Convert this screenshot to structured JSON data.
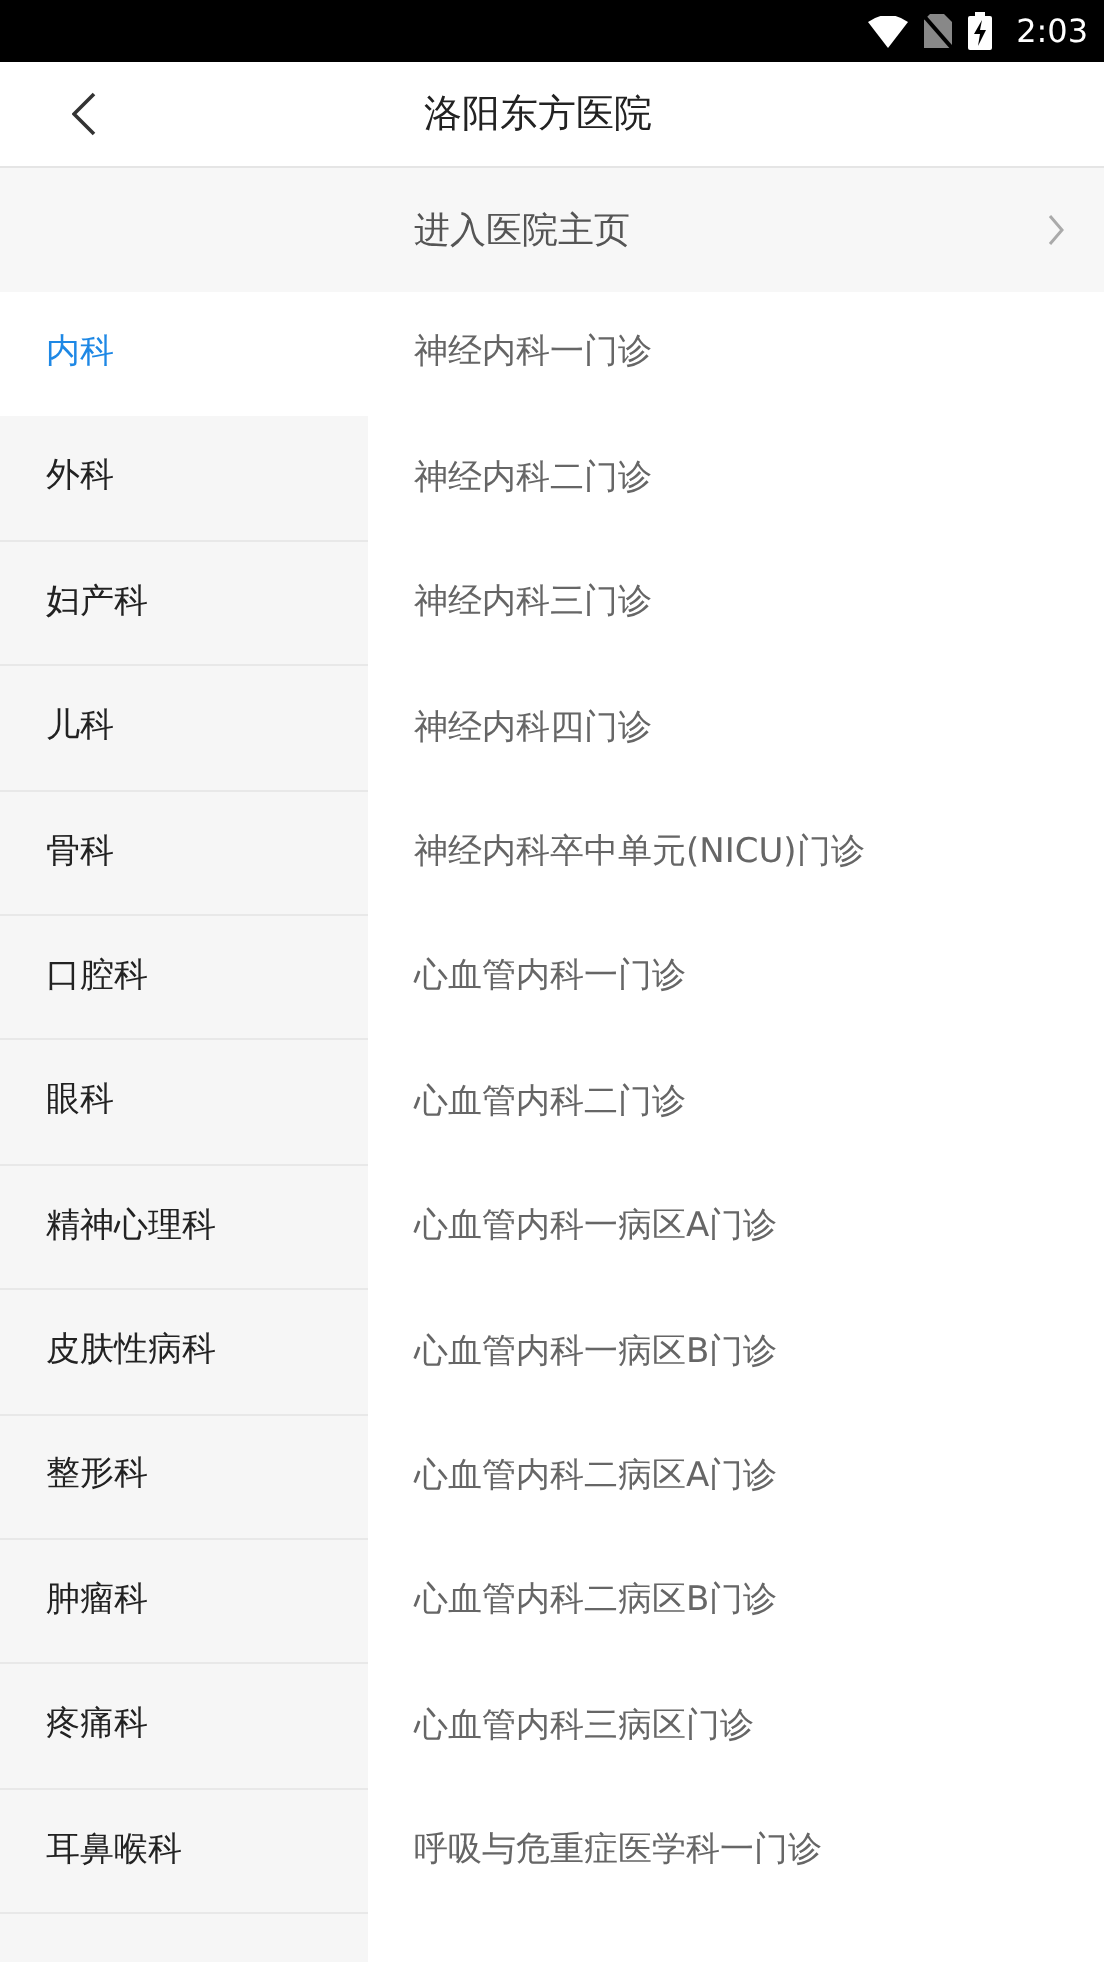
{
  "status_bar": {
    "time": "2:03"
  },
  "header": {
    "title": "洛阳东方医院"
  },
  "hospital_link": {
    "label": "进入医院主页"
  },
  "departments": [
    {
      "label": "内科",
      "selected": true
    },
    {
      "label": "外科",
      "selected": false
    },
    {
      "label": "妇产科",
      "selected": false
    },
    {
      "label": "儿科",
      "selected": false
    },
    {
      "label": "骨科",
      "selected": false
    },
    {
      "label": "口腔科",
      "selected": false
    },
    {
      "label": "眼科",
      "selected": false
    },
    {
      "label": "精神心理科",
      "selected": false
    },
    {
      "label": "皮肤性病科",
      "selected": false
    },
    {
      "label": "整形科",
      "selected": false
    },
    {
      "label": "肿瘤科",
      "selected": false
    },
    {
      "label": "疼痛科",
      "selected": false
    },
    {
      "label": "耳鼻喉科",
      "selected": false
    }
  ],
  "clinics": [
    "神经内科一门诊",
    "神经内科二门诊",
    "神经内科三门诊",
    "神经内科四门诊",
    "神经内科卒中单元(NICU)门诊",
    "心血管内科一门诊",
    "心血管内科二门诊",
    "心血管内科一病区A门诊",
    "心血管内科一病区B门诊",
    "心血管内科二病区A门诊",
    "心血管内科二病区B门诊",
    "心血管内科三病区门诊",
    "呼吸与危重症医学科一门诊"
  ]
}
